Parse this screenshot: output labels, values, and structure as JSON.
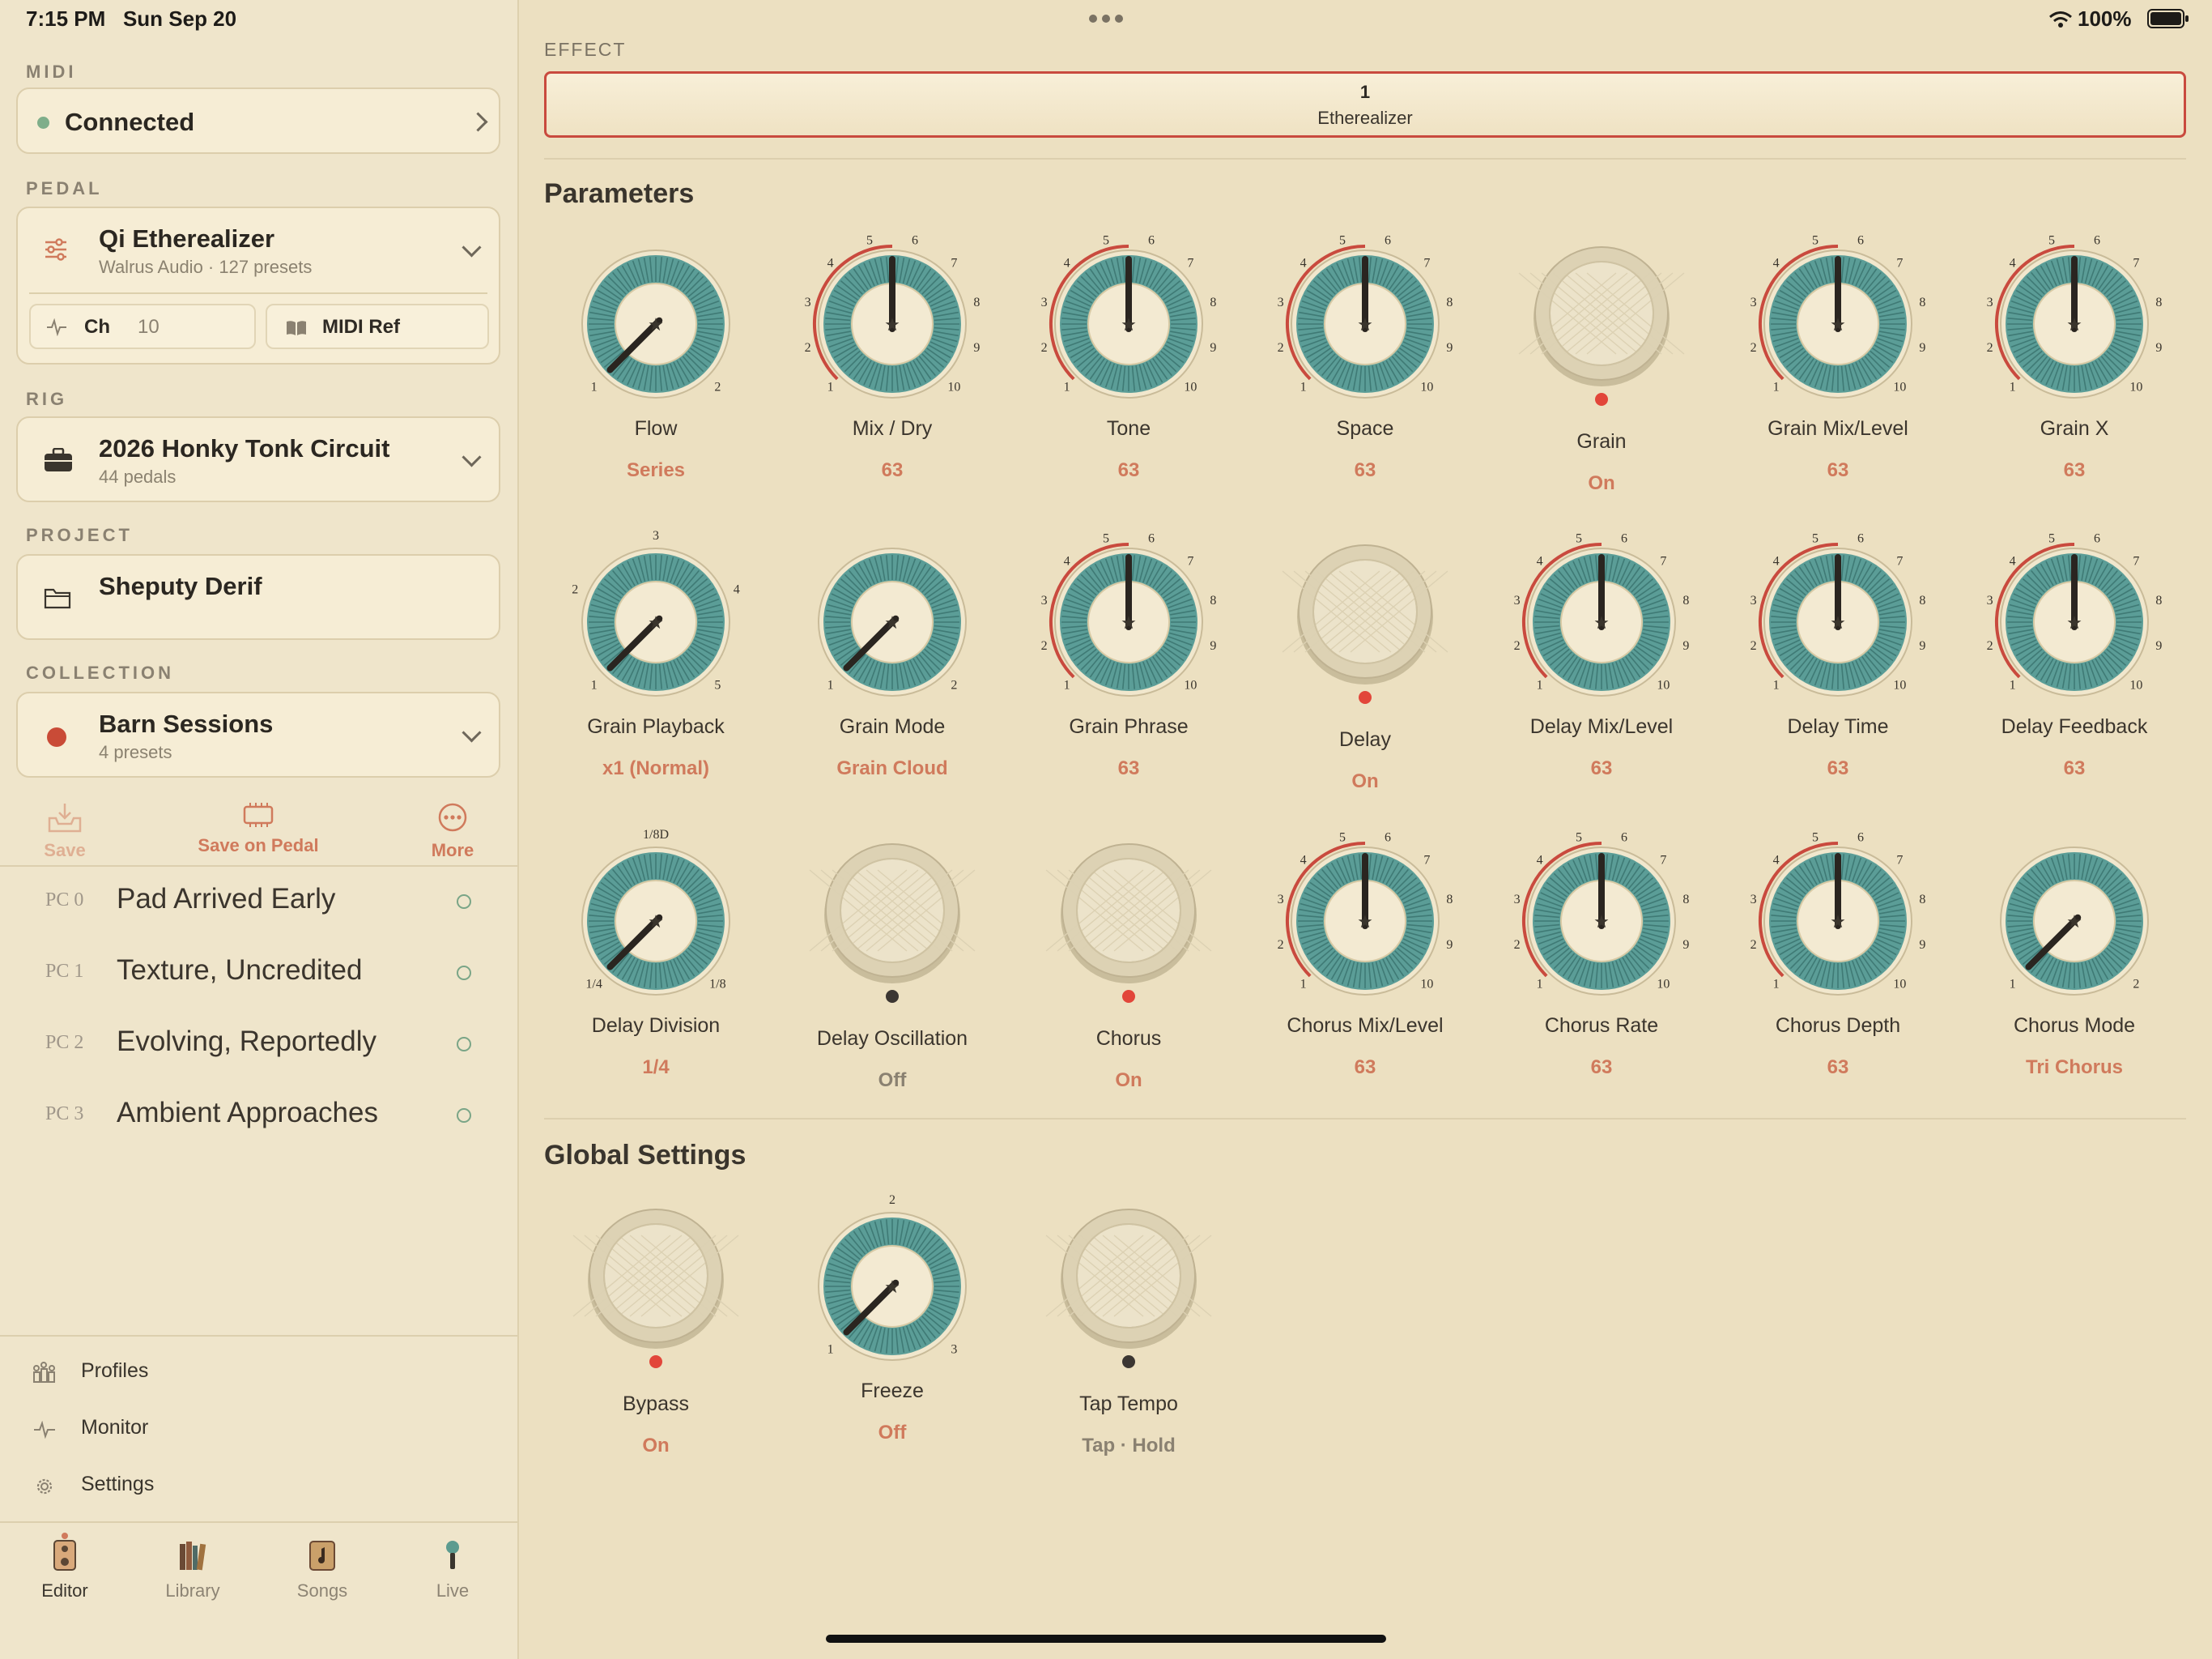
{
  "status": {
    "time": "7:15 PM",
    "date": "Sun Sep 20",
    "battery": "100%"
  },
  "sidebar": {
    "midi": {
      "label": "MIDI",
      "status": "Connected",
      "status_color": "#7fae8a"
    },
    "pedal": {
      "label": "PEDAL",
      "name": "Qi Etherealizer",
      "sub": "Walrus Audio · 127 presets",
      "ch_label": "Ch",
      "ch_value": "10",
      "midi_ref": "MIDI Ref"
    },
    "rig": {
      "label": "RIG",
      "name": "2026 Honky Tonk Circuit",
      "sub": "44 pedals"
    },
    "project": {
      "label": "PROJECT",
      "name": "Sheputy Derif"
    },
    "collection": {
      "label": "COLLECTION",
      "name": "Barn Sessions",
      "sub": "4 presets",
      "color": "#c94b37"
    },
    "actions": {
      "save": "Save",
      "save_on_pedal": "Save on Pedal",
      "more": "More"
    },
    "presets": [
      {
        "pc": "PC 0",
        "name": "Pad Arrived Early"
      },
      {
        "pc": "PC 1",
        "name": "Texture, Uncredited"
      },
      {
        "pc": "PC 2",
        "name": "Evolving, Reportedly"
      },
      {
        "pc": "PC 3",
        "name": "Ambient Approaches"
      }
    ],
    "nav": [
      {
        "name": "profiles",
        "label": "Profiles",
        "icon": "profiles-icon"
      },
      {
        "name": "monitor",
        "label": "Monitor",
        "icon": "pulse-icon"
      },
      {
        "name": "settings",
        "label": "Settings",
        "icon": "gear-icon"
      }
    ],
    "tabs": [
      {
        "name": "editor",
        "label": "Editor",
        "icon": "pedal-icon",
        "active": true
      },
      {
        "name": "library",
        "label": "Library",
        "icon": "books-icon"
      },
      {
        "name": "songs",
        "label": "Songs",
        "icon": "music-note-icon"
      },
      {
        "name": "live",
        "label": "Live",
        "icon": "microphone-icon"
      }
    ]
  },
  "main": {
    "effect_label": "EFFECT",
    "effect": {
      "number": "1",
      "name": "Etherealizer"
    },
    "parameters_title": "Parameters",
    "global_title": "Global Settings"
  },
  "parameters": [
    {
      "name": "flow",
      "label": "Flow",
      "value": "Series",
      "type": "selector",
      "ticks": [
        "1",
        "2"
      ],
      "level": 0
    },
    {
      "name": "mix-dry",
      "label": "Mix / Dry",
      "value": "63",
      "type": "dial",
      "level": 0.5
    },
    {
      "name": "tone",
      "label": "Tone",
      "value": "63",
      "type": "dial",
      "level": 0.5
    },
    {
      "name": "space",
      "label": "Space",
      "value": "63",
      "type": "dial",
      "level": 0.5
    },
    {
      "name": "grain",
      "label": "Grain",
      "value": "On",
      "type": "switch",
      "on": true
    },
    {
      "name": "grain-mix-level",
      "label": "Grain Mix/Level",
      "value": "63",
      "type": "dial",
      "level": 0.5
    },
    {
      "name": "grain-x",
      "label": "Grain X",
      "value": "63",
      "type": "dial",
      "level": 0.5
    },
    {
      "name": "grain-playback",
      "label": "Grain Playback",
      "value": "x1 (Normal)",
      "type": "selector",
      "ticks": [
        "1",
        "2",
        "3",
        "4",
        "5"
      ],
      "level": 0
    },
    {
      "name": "grain-mode",
      "label": "Grain Mode",
      "value": "Grain Cloud",
      "type": "selector",
      "ticks": [
        "1",
        "2"
      ],
      "level": 0
    },
    {
      "name": "grain-phrase",
      "label": "Grain Phrase",
      "value": "63",
      "type": "dial",
      "level": 0.5
    },
    {
      "name": "delay",
      "label": "Delay",
      "value": "On",
      "type": "switch",
      "on": true
    },
    {
      "name": "delay-mix-level",
      "label": "Delay Mix/Level",
      "value": "63",
      "type": "dial",
      "level": 0.5
    },
    {
      "name": "delay-time",
      "label": "Delay Time",
      "value": "63",
      "type": "dial",
      "level": 0.5
    },
    {
      "name": "delay-feedback",
      "label": "Delay Feedback",
      "value": "63",
      "type": "dial",
      "level": 0.5
    },
    {
      "name": "delay-division",
      "label": "Delay Division",
      "value": "1/4",
      "type": "selector",
      "ticks": [
        "1/4",
        "1/8D",
        "1/8"
      ],
      "level": 0
    },
    {
      "name": "delay-oscillation",
      "label": "Delay Oscillation",
      "value": "Off",
      "type": "switch",
      "on": false
    },
    {
      "name": "chorus",
      "label": "Chorus",
      "value": "On",
      "type": "switch",
      "on": true
    },
    {
      "name": "chorus-mix-level",
      "label": "Chorus Mix/Level",
      "value": "63",
      "type": "dial",
      "level": 0.5
    },
    {
      "name": "chorus-rate",
      "label": "Chorus Rate",
      "value": "63",
      "type": "dial",
      "level": 0.5
    },
    {
      "name": "chorus-depth",
      "label": "Chorus Depth",
      "value": "63",
      "type": "dial",
      "level": 0.5
    },
    {
      "name": "chorus-mode",
      "label": "Chorus Mode",
      "value": "Tri Chorus",
      "type": "selector",
      "ticks": [
        "1",
        "2"
      ],
      "level": 0
    }
  ],
  "global": [
    {
      "name": "bypass",
      "label": "Bypass",
      "value": "On",
      "type": "switch",
      "on": true
    },
    {
      "name": "freeze",
      "label": "Freeze",
      "value": "Off",
      "type": "selector",
      "ticks": [
        "1",
        "2",
        "3"
      ],
      "level": 0
    },
    {
      "name": "tap-tempo",
      "label": "Tap Tempo",
      "value": "Tap · Hold",
      "type": "switch",
      "on": false,
      "plain": true
    }
  ],
  "dial_ticks": [
    "1",
    "2",
    "3",
    "4",
    "5",
    "6",
    "7",
    "8",
    "9",
    "10"
  ],
  "colors": {
    "accent": "#c94a3e",
    "value": "#d07a5c",
    "teal": "#5b9d97",
    "cream": "#f3ead2",
    "led_on": "#e2463a",
    "led_off": "#3b3632"
  }
}
